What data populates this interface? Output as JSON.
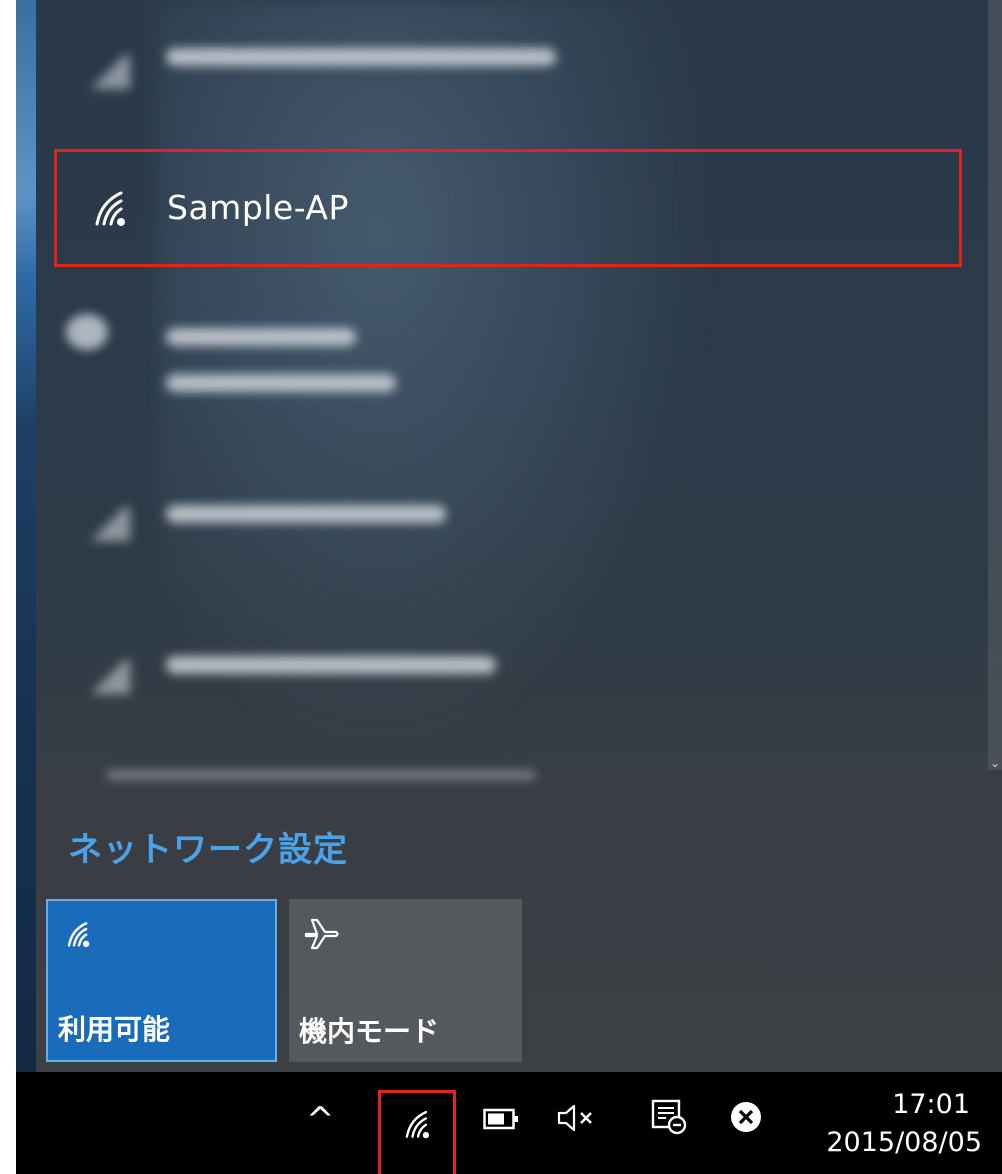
{
  "network_list": {
    "selected_network": {
      "name": "Sample-AP",
      "icon": "wifi-signal-icon"
    }
  },
  "network_settings_label": "ネットワーク設定",
  "quick_actions": {
    "wifi": {
      "label": "利用可能",
      "icon": "wifi-icon",
      "active": true,
      "color": "#1a6cbb"
    },
    "airplane": {
      "label": "機内モード",
      "icon": "airplane-icon",
      "active": false,
      "color": "#55585d"
    }
  },
  "taskbar": {
    "chevron_icon": "show-hidden-icons-chevron",
    "wifi_icon": "wifi-icon",
    "battery_icon": "battery-icon",
    "volume_icon": "muted-volume-icon",
    "notes_icon": "notification-center-icon",
    "close_icon": "circle-x-icon",
    "time": "17:01",
    "date": "2015/08/05"
  },
  "colors": {
    "highlight": "#e0261c",
    "link": "#4aa3e8",
    "taskbar": "#000000"
  }
}
